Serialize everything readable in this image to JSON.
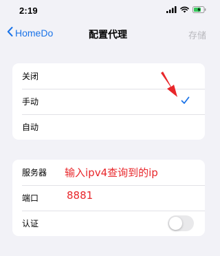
{
  "status_bar": {
    "time": "2:19"
  },
  "nav": {
    "back_label": "HomeDo",
    "title": "配置代理",
    "save_label": "存储"
  },
  "proxy_modes": [
    {
      "label": "关闭",
      "selected": false
    },
    {
      "label": "手动",
      "selected": true
    },
    {
      "label": "自动",
      "selected": false
    }
  ],
  "settings": {
    "server_label": "服务器",
    "server_value": "输入ipv4查询到的ip",
    "port_label": "端口",
    "port_value": "8881",
    "auth_label": "认证",
    "auth_enabled": false
  },
  "colors": {
    "accent": "#1a73e8",
    "annotation": "#e8262a",
    "background": "#f2f2f7"
  }
}
